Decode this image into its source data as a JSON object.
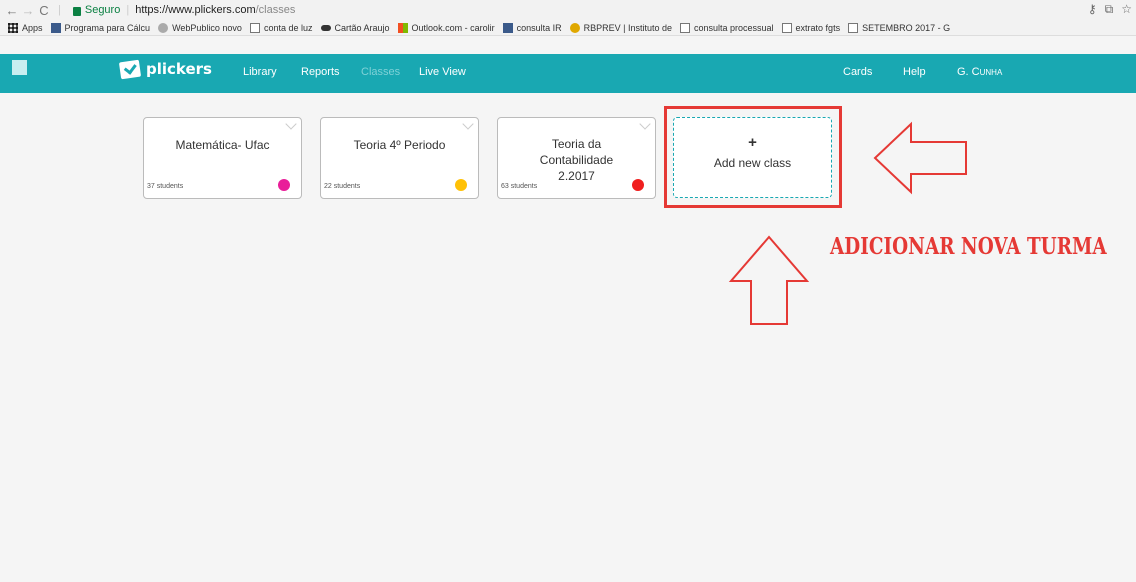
{
  "browser": {
    "secure_label": "Seguro",
    "url_host": "https://www.plickers.com",
    "url_path": "/classes"
  },
  "bookmarks": [
    {
      "label": "Apps",
      "icon": "apps-grid-icon"
    },
    {
      "label": "Programa para Cálcu",
      "icon": "site-favicon"
    },
    {
      "label": "WebPublico novo",
      "icon": "globe-icon"
    },
    {
      "label": "conta de luz",
      "icon": "page-icon"
    },
    {
      "label": "Cartão Araujo",
      "icon": "card-icon"
    },
    {
      "label": "Outlook.com - carolir",
      "icon": "outlook-icon"
    },
    {
      "label": "consulta IR",
      "icon": "site-favicon"
    },
    {
      "label": "RBPREV | Instituto de",
      "icon": "rbprev-icon"
    },
    {
      "label": "consulta processual",
      "icon": "page-icon"
    },
    {
      "label": "extrato fgts",
      "icon": "page-icon"
    },
    {
      "label": "SETEMBRO 2017 - G",
      "icon": "page-icon"
    }
  ],
  "nav": {
    "logo": "plickers",
    "links": [
      "Library",
      "Reports",
      "Classes",
      "Live View"
    ],
    "active": "Classes",
    "right": [
      "Cards",
      "Help",
      "G. Cunha"
    ]
  },
  "classes": [
    {
      "title": "Matemática- Ufac",
      "students": "37 students",
      "color": "#e91e99"
    },
    {
      "title": "Teoria 4º Periodo",
      "students": "22 students",
      "color": "#ffc107"
    },
    {
      "title": "Teoria da Contabilidade 2.2017",
      "students": "63 students",
      "color": "#f01f1f"
    }
  ],
  "add_class": {
    "plus": "+",
    "label": "Add new class"
  },
  "annotation": {
    "text": "ADICIONAR NOVA TURMA",
    "color": "#e53935"
  }
}
